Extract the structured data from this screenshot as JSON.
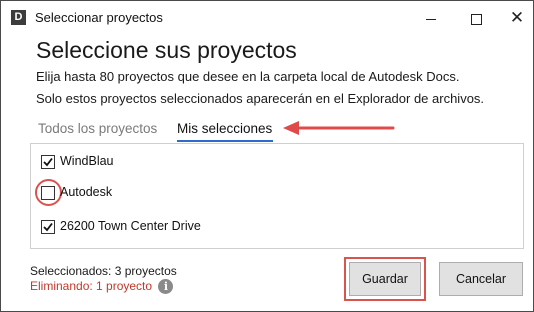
{
  "window": {
    "title": "Seleccionar proyectos",
    "app_icon_letter": "D",
    "controls": {
      "minimize": "",
      "maximize": "",
      "close": "✕"
    }
  },
  "header": {
    "title": "Seleccione sus proyectos",
    "description_line1": "Elija hasta 80 proyectos que desee en la carpeta local de Autodesk Docs.",
    "description_line2": "Solo estos proyectos seleccionados aparecerán en el Explorador de archivos."
  },
  "tabs": [
    {
      "label": "Todos los proyectos",
      "active": false
    },
    {
      "label": "Mis selecciones",
      "active": true
    }
  ],
  "projects": [
    {
      "name": "WindBlau",
      "checked": true
    },
    {
      "name": "Autodesk",
      "checked": false,
      "highlighted": true
    },
    {
      "name": "26200 Town Center Drive",
      "checked": true
    }
  ],
  "status": {
    "selected": "Seleccionados: 3 proyectos",
    "removing": "Eliminando: 1 proyecto",
    "info_icon": "info-icon"
  },
  "buttons": {
    "save": "Guardar",
    "cancel": "Cancelar"
  },
  "colors": {
    "accent": "#2d6ccc",
    "annotation": "#d9534f",
    "removing_text": "#c0392b"
  }
}
